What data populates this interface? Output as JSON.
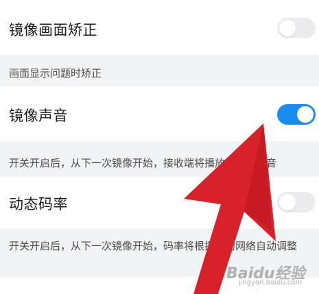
{
  "settings": {
    "mirror_correction": {
      "title": "镜像画面矫正",
      "enabled": false,
      "description": "画面显示问题时矫正"
    },
    "mirror_sound": {
      "title": "镜像声音",
      "enabled": true,
      "description": "开关开启后，从下一次镜像开始，接收端将播放镜像的声音"
    },
    "dynamic_bitrate": {
      "title": "动态码率",
      "enabled": false,
      "description": "开关开启后，从下一次镜像开始，码率将根据您的网络自动调整"
    }
  },
  "colors": {
    "accent": "#1a8cf0",
    "arrow": "#d8222a",
    "background": "#f2f3f5"
  },
  "watermark": {
    "logo_text": "Baidu经验",
    "url": "jingyan.baidu.com"
  }
}
